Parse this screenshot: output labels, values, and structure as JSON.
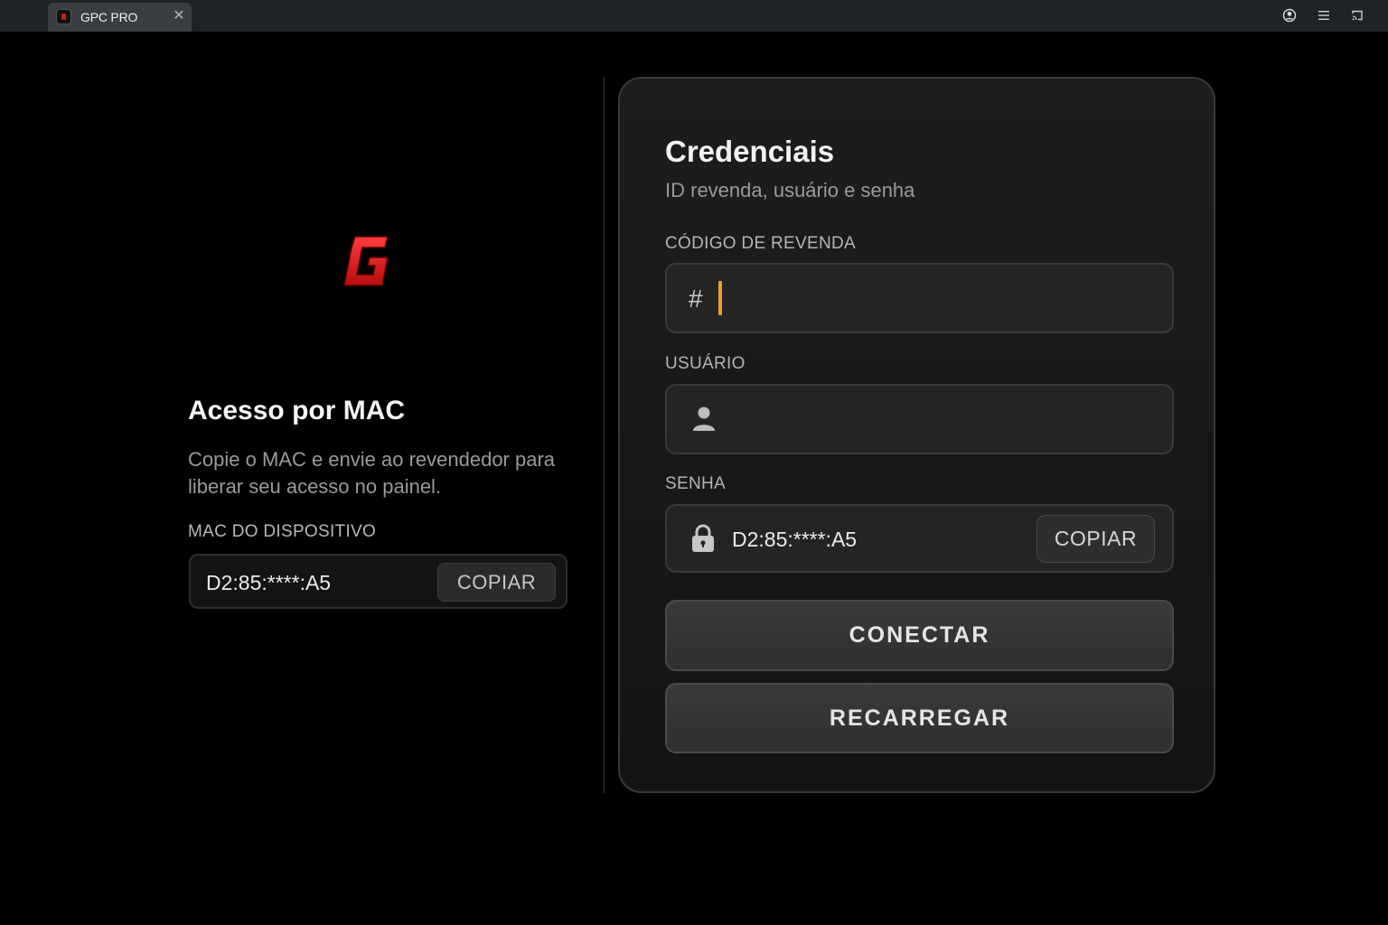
{
  "browser": {
    "tab_title": "GPC PRO"
  },
  "mac_panel": {
    "title": "Acesso por MAC",
    "description": "Copie o MAC e envie ao revendedor para liberar seu acesso no painel.",
    "mac_label": "MAC DO DISPOSITIVO",
    "mac_value": "D2:85:****:A5",
    "copy_label": "COPIAR"
  },
  "credentials": {
    "title": "Credenciais",
    "subtitle": "ID revenda, usuário e senha",
    "codigo_label": "CÓDIGO DE REVENDA",
    "codigo_prefix": "#",
    "codigo_value": "",
    "usuario_label": "USUÁRIO",
    "usuario_value": "",
    "senha_label": "SENHA",
    "senha_value": "D2:85:****:A5",
    "senha_copy_label": "COPIAR",
    "connect_label": "CONECTAR",
    "reload_label": "RECARREGAR"
  },
  "icons": {
    "account": "account-circle-icon",
    "menu": "menu-icon",
    "cast": "cast-icon",
    "user": "person-icon",
    "lock": "lock-icon"
  },
  "colors": {
    "accent_caret": "#f0a020",
    "logo_red": "#d21818",
    "background": "#000000",
    "card": "#1a1a1a"
  }
}
